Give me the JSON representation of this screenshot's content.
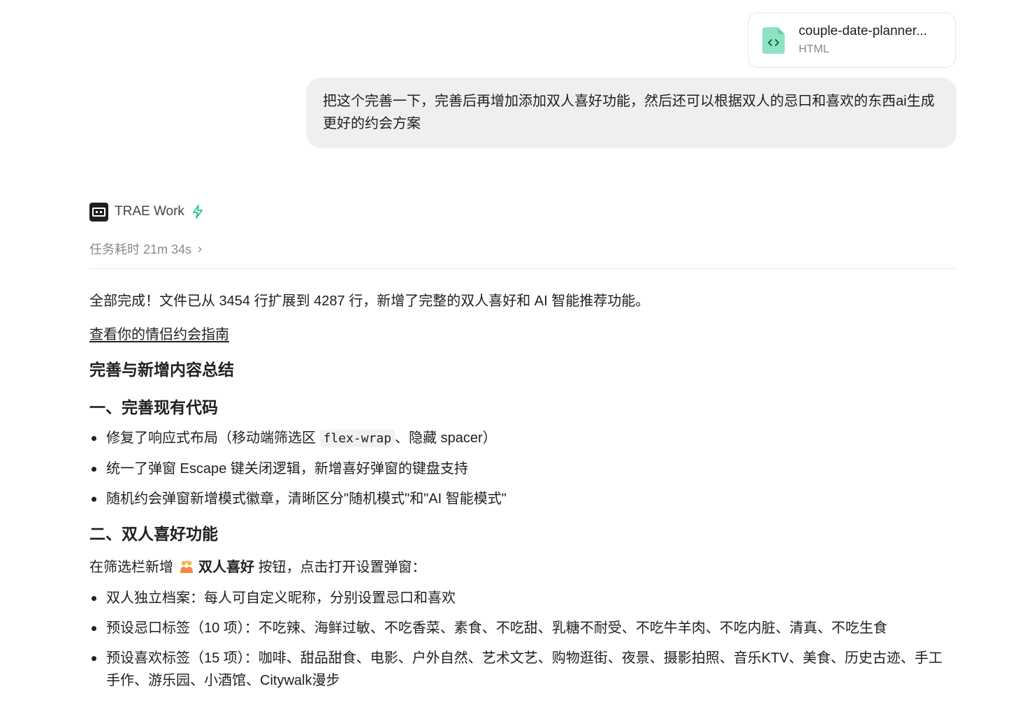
{
  "attachment": {
    "file_name": "couple-date-planner...",
    "file_type": "HTML",
    "icon": "code-file-icon",
    "icon_color": "#5fd4a8"
  },
  "user_message": "把这个完善一下，完善后再增加添加双人喜好功能，然后还可以根据双人的忌口和喜欢的东西ai生成更好的约会方案",
  "assistant": {
    "name": "TRAE Work",
    "logo_icon": "trae-logo-icon",
    "bolt_icon": "bolt-icon",
    "bolt_color": "#2bc48a",
    "task_time_label": "任务耗时 21m 34s",
    "task_time_chevron": "›"
  },
  "content": {
    "summary": "全部完成！文件已从 3454 行扩展到 4287 行，新增了完整的双人喜好和 AI 智能推荐功能。",
    "link_text": "查看你的情侣约会指南",
    "heading_main": "完善与新增内容总结",
    "section1": {
      "heading": "一、完善现有代码",
      "bullets": [
        {
          "before": "修复了响应式布局（移动端筛选区 ",
          "code": "flex-wrap",
          "after": "、隐藏 spacer）"
        },
        {
          "text": "统一了弹窗 Escape 键关闭逻辑，新增喜好弹窗的键盘支持"
        },
        {
          "text": "随机约会弹窗新增模式徽章，清晰区分\"随机模式\"和\"AI 智能模式\""
        }
      ]
    },
    "section2": {
      "heading": "二、双人喜好功能",
      "intro_before": "在筛选栏新增",
      "intro_emoji": "couple-emoji-icon",
      "intro_bold": "双人喜好",
      "intro_after": " 按钮，点击打开设置弹窗：",
      "bullets": [
        "双人独立档案：每人可自定义昵称，分别设置忌口和喜欢",
        "预设忌口标签（10 项）：不吃辣、海鲜过敏、不吃香菜、素食、不吃甜、乳糖不耐受、不吃牛羊肉、不吃内脏、清真、不吃生食",
        "预设喜欢标签（15 项）：咖啡、甜品甜食、电影、户外自然、艺术文艺、购物逛街、夜景、摄影拍照、音乐KTV、美食、历史古迹、手工手作、游乐园、小酒馆、Citywalk漫步"
      ]
    }
  }
}
